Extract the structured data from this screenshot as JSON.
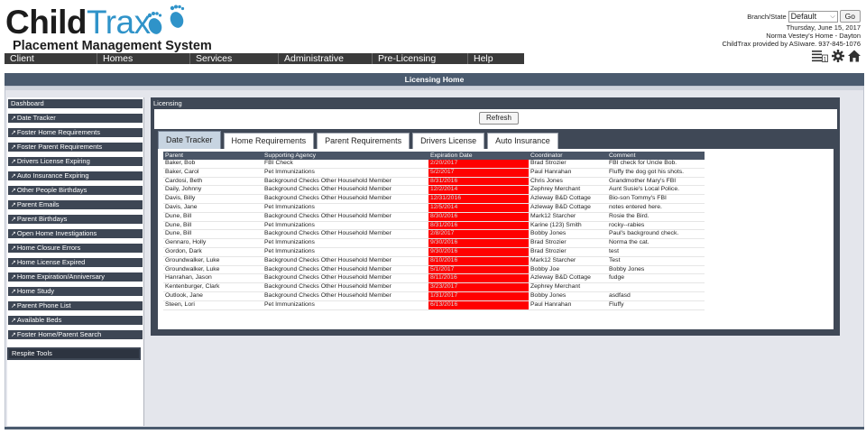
{
  "app": {
    "logo_bold": "Child",
    "logo_light": "Trax",
    "tagline": "Placement Management System"
  },
  "nav": [
    "Client",
    "Homes",
    "Services",
    "Administrative",
    "Pre-Licensing",
    "Help"
  ],
  "topright": {
    "branch_label": "Branch/State",
    "branch_value": "Default",
    "go_label": "Go",
    "date": "Thursday, June 15, 2017",
    "user_home": "Norma Vestey's Home - Dayton",
    "provided_by": "ChildTrax provided by ASIware. 937-845-1076",
    "icons": [
      "list-icon",
      "gear-icon",
      "home-icon"
    ],
    "list_badge": "1"
  },
  "page_title": "Licensing Home",
  "sidebar": {
    "items": [
      "Dashboard",
      "Date Tracker",
      "Foster Home Requirements",
      "Foster Parent Requirements",
      "Drivers License Expiring",
      "Auto Insurance Expiring",
      "Other People Birthdays",
      "Parent Emails",
      "Parent Birthdays",
      "Open Home Investigations",
      "Home Closure Errors",
      "Home License Expired",
      "Home Expiration/Anniversary",
      "Home Study",
      "Parent Phone List",
      "Available Beds",
      "Foster Home/Parent Search"
    ],
    "respite": "Respite Tools"
  },
  "panel": {
    "title": "Licensing",
    "refresh_label": "Refresh",
    "tabs": [
      "Date Tracker",
      "Home Requirements",
      "Parent Requirements",
      "Drivers License",
      "Auto Insurance"
    ],
    "active_tab": "Date Tracker",
    "expired_color": "#ff0000"
  },
  "table": {
    "headers": [
      "Parent",
      "Supporting Agency",
      "Expiration Date",
      "Coordinator",
      "Comment"
    ],
    "rows": [
      [
        "Baker, Bob",
        "FBI Check",
        "2/20/2017",
        "Brad Strozier",
        "FBI check for Uncle Bob."
      ],
      [
        "Baker, Carol",
        "Pet Immunizations",
        "5/2/2017",
        "Paul Hanrahan",
        "Fluffy the dog got his shots."
      ],
      [
        "Cardosi, Beth",
        "Background Checks Other Household Member",
        "8/31/2016",
        "Chris Jones",
        "Grandmother Mary's FBI"
      ],
      [
        "Daily, Johnny",
        "Background Checks Other Household Member",
        "12/2/2014",
        "Zephrey Merchant",
        "Aunt Susie's Local Police."
      ],
      [
        "Davis, Billy",
        "Background Checks Other Household Member",
        "12/31/2016",
        "Azleway B&D Cottage",
        "Bio-son Tommy's FBI"
      ],
      [
        "Davis, Jane",
        "Pet Immunizations",
        "12/5/2014",
        "Azleway B&D Cottage",
        "notes entered here."
      ],
      [
        "Dune, Bill",
        "Background Checks Other Household Member",
        "8/30/2016",
        "Mark12 Starcher",
        "Rosie the Bird."
      ],
      [
        "Dune, Bill",
        "Pet Immunizations",
        "8/31/2016",
        "Karine (123) Smith",
        "rocky--rabies"
      ],
      [
        "Dune, Bill",
        "Background Checks Other Household Member",
        "2/8/2017",
        "Bobby Jones",
        "Paul's background check."
      ],
      [
        "Gennaro, Holly",
        "Pet Immunizations",
        "9/30/2016",
        "Brad Strozier",
        "Norma the cat."
      ],
      [
        "Gordon, Dark",
        "Pet Immunizations",
        "9/30/2016",
        "Brad Strozier",
        "test"
      ],
      [
        "Groundwalker, Luke",
        "Background Checks Other Household Member",
        "8/10/2016",
        "Mark12 Starcher",
        "Test"
      ],
      [
        "Groundwalker, Luke",
        "Background Checks Other Household Member",
        "5/1/2017",
        "Bobby Joe",
        "Bobby Jones"
      ],
      [
        "Hanrahan, Jason",
        "Background Checks Other Household Member",
        "8/11/2016",
        "Azleway B&D Cottage",
        "fudge"
      ],
      [
        "Kentenburger, Clark",
        "Background Checks Other Household Member",
        "3/23/2017",
        "Zephrey Merchant",
        ""
      ],
      [
        "Outlook, Jane",
        "Background Checks Other Household Member",
        "1/31/2017",
        "Bobby Jones",
        "asdfasd"
      ],
      [
        "Steen, Lori",
        "Pet Immunizations",
        "6/13/2016",
        "Paul Hanrahan",
        "Fluffy"
      ]
    ]
  }
}
